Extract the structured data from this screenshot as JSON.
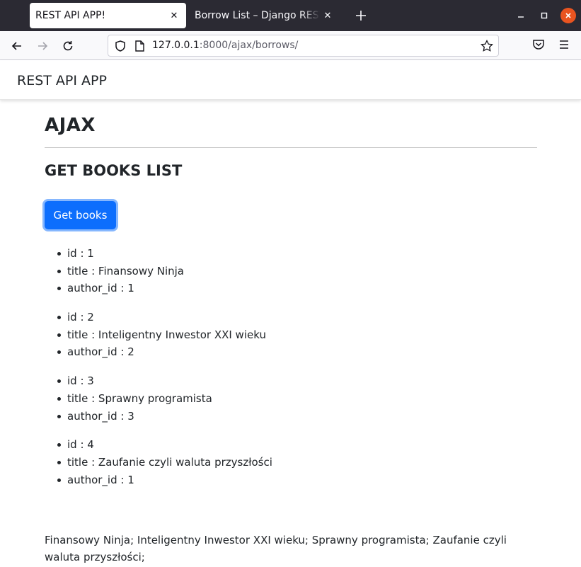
{
  "browser": {
    "tabs": [
      {
        "title": "REST API APP!",
        "active": true
      },
      {
        "title": "Borrow List – Django REST framework",
        "active": false
      }
    ],
    "url": {
      "host": "127.0.0.1",
      "path": ":8000/ajax/borrows/"
    }
  },
  "page": {
    "brand": "REST API APP",
    "heading": "AJAX",
    "subheading": "GET BOOKS LIST",
    "button_label": "Get books",
    "books": [
      {
        "id": "id : 1",
        "title": "title : Finansowy Ninja",
        "author": "author_id : 1"
      },
      {
        "id": "id : 2",
        "title": "title : Inteligentny Inwestor XXI wieku",
        "author": "author_id : 2"
      },
      {
        "id": "id : 3",
        "title": "title : Sprawny programista",
        "author": "author_id : 3"
      },
      {
        "id": "id : 4",
        "title": "title : Zaufanie czyli waluta przyszłości",
        "author": "author_id : 1"
      }
    ],
    "summary": "Finansowy Ninja; Inteligentny Inwestor XXI wieku; Sprawny programista; Zaufanie czyli waluta przyszłości;"
  },
  "colors": {
    "primary": "#0d6efd",
    "tabbar": "#2b2a33",
    "close": "#e95420"
  }
}
